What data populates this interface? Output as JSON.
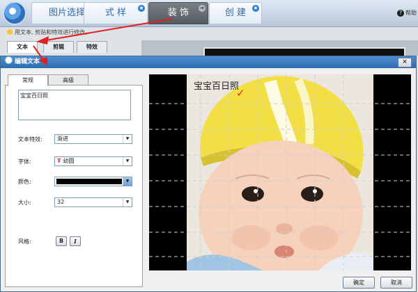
{
  "toolbar": {
    "tabs": [
      {
        "label": "图片选择",
        "active": false
      },
      {
        "label": "式 样",
        "active": false
      },
      {
        "label": "装 饰",
        "active": true
      },
      {
        "label": "创 建",
        "active": false
      }
    ],
    "help_label": "帮助"
  },
  "hint": "用文本, 剪贴和特效进行修改。",
  "subtabs": [
    "文本",
    "剪辑",
    "特效"
  ],
  "dialog": {
    "title": "编辑文本",
    "close_label": "×",
    "tabs": [
      "常规",
      "高级"
    ],
    "text_value": "宝宝百日照",
    "fields": {
      "effect": {
        "label": "文本特效:",
        "value": "渐进"
      },
      "font": {
        "label": "字体:",
        "value": "幼圆",
        "icon": "font-icon"
      },
      "color": {
        "label": "颜色:",
        "value": "#000000"
      },
      "size": {
        "label": "大小:",
        "value": "32"
      },
      "style": {
        "label": "风格:",
        "bold": "B",
        "italic": "I"
      }
    },
    "preview": {
      "overlay_text": "宝宝百日照",
      "check_mark": "✓"
    },
    "ok_label": "确定",
    "cancel_label": "取消"
  },
  "colors": {
    "title_bar": "#2e6cb0",
    "accent_arrow": "#e12020",
    "active_tab": "#5a5f66"
  }
}
